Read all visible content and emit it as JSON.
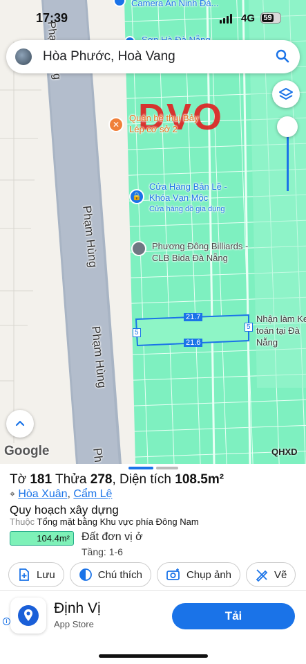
{
  "status_bar": {
    "time": "17:39",
    "network": "4G",
    "battery": "59"
  },
  "search": {
    "query": "Hòa Phước, Hoà Vang"
  },
  "map": {
    "roads": [
      {
        "name": "Phạm Hùng"
      },
      {
        "name": "Phạm Hùng"
      },
      {
        "name": "Phạm Hùng"
      },
      {
        "name": "Ph"
      }
    ],
    "pois": [
      {
        "name": "Camera An Ninh Đà..."
      },
      {
        "name": "Sơn Hà Đà Nẵng"
      },
      {
        "name": "Quán bê thui Bảy Lép cơ sở 2"
      },
      {
        "name": "Cửa Hàng Bản Lề - Khóa Vạn Mộc",
        "category": "Cửa hàng đồ gia dụng"
      },
      {
        "name": "Phương Đông Billiards - CLB Bida Đà Nẵng"
      },
      {
        "name": "Nhận làm Ke toán tại Đà Nẵng"
      }
    ],
    "watermark": "DVO",
    "parcel_dims": {
      "top": "21.7",
      "bottom": "21.6",
      "left": "5",
      "right": "5"
    },
    "attribution": "Google",
    "layer_tag": "QHXD"
  },
  "parcel": {
    "to_label": "Tờ",
    "to_value": "181",
    "thua_label": "Thửa",
    "thua_value": "278",
    "area_label": "Diện tích",
    "area_value": "108.5m²",
    "ward": "Hòa Xuân",
    "district": "Cẩm Lệ",
    "planning_title": "Quy hoạch xây dựng",
    "belongs_label": "Thuộc",
    "belongs_value": "Tổng mặt bằng Khu vực phía Đông Nam",
    "zone_area": "104.4m²",
    "land_type": "Đất đơn vị ở",
    "floors": "Tầng: 1-6"
  },
  "actions": [
    {
      "label": "Lưu",
      "icon": "save-icon"
    },
    {
      "label": "Chú thích",
      "icon": "legend-icon"
    },
    {
      "label": "Chụp ảnh",
      "icon": "camera-icon"
    },
    {
      "label": "Vẽ",
      "icon": "draw-icon"
    }
  ],
  "ad": {
    "app_name": "Định Vị",
    "store": "App Store",
    "cta": "Tải",
    "info": "i"
  },
  "colors": {
    "accent": "#1a73e8",
    "parcel_fill": "#7ef1b8",
    "road": "#a8b4c4",
    "watermark": "#e02020"
  }
}
